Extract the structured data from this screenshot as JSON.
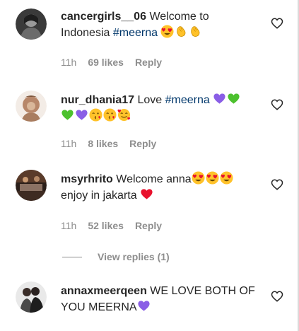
{
  "comments": [
    {
      "username": "cancergirls__06",
      "text": "Welcome to Indonesia ",
      "hashtag": "#meerna",
      "emojis": [
        "heart-eyes",
        "clap",
        "clap"
      ],
      "time": "11h",
      "likes": "69 likes",
      "reply": "Reply"
    },
    {
      "username": "nur_dhania17",
      "text": "Love ",
      "hashtag": "#meerna",
      "emojis": [
        "purple-heart",
        "green-heart",
        "green-heart",
        "purple-heart",
        "kiss-face",
        "kiss-face",
        "smiling-hearts"
      ],
      "time": "11h",
      "likes": "8 likes",
      "reply": "Reply"
    },
    {
      "username": "msyrhrito",
      "text": "Welcome anna",
      "text2": "enjoy in jakarta ",
      "emojis": [
        "heart-eyes",
        "heart-eyes",
        "heart-eyes",
        "red-heart"
      ],
      "time": "11h",
      "likes": "52 likes",
      "reply": "Reply",
      "view_replies": "View replies (1)"
    },
    {
      "username": "annaxmeerqeen",
      "text": "WE LOVE BOTH OF YOU MEERNA",
      "emojis": [
        "purple-heart"
      ]
    }
  ],
  "colors": {
    "username": "#262626",
    "hashtag": "#00376b",
    "meta": "#8e8e8e",
    "purple_heart": "#8a5ee6",
    "green_heart": "#4cc12e",
    "red_heart": "#e8112d",
    "emoji_yellow": "#ffc22a"
  }
}
